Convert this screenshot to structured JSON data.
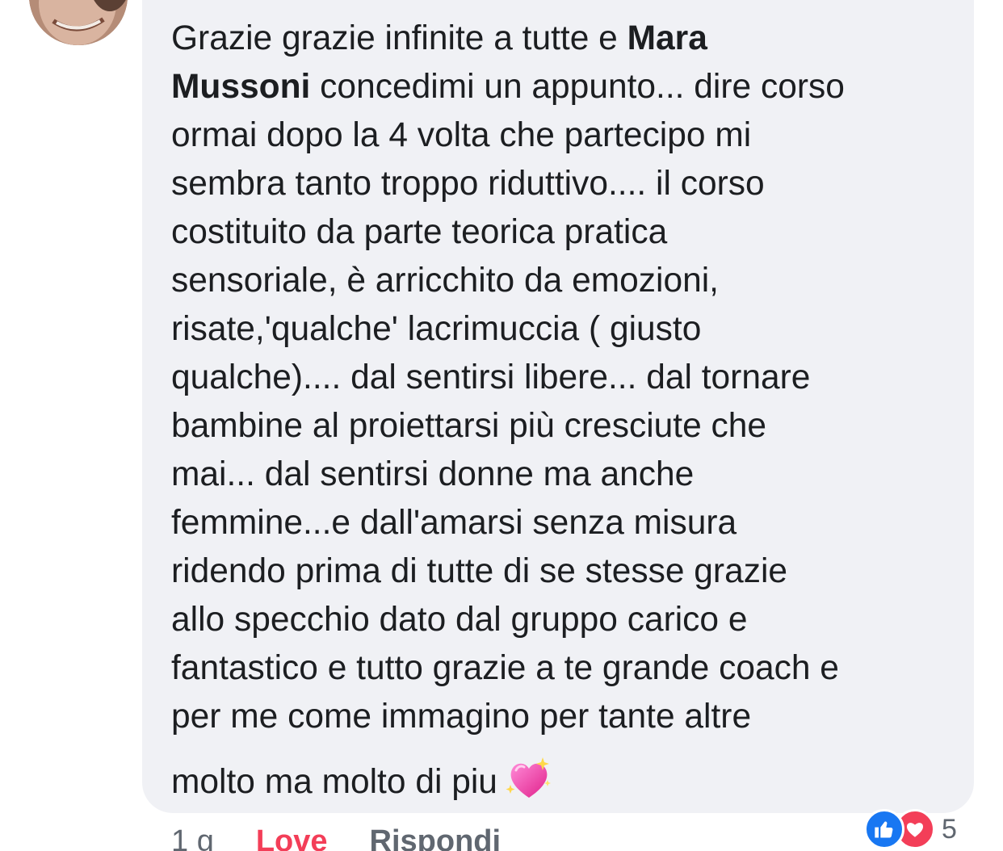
{
  "comment": {
    "author": "",
    "lines": [
      {
        "before": "Grazie grazie infinite a tutte e ",
        "mention": "Mara"
      },
      {
        "mention": "Mussoni",
        "after": " concedimi un appunto... dire corso"
      },
      "ormai dopo la 4 volta che partecipo mi",
      "sembra tanto troppo riduttivo.... il corso",
      "costituito da parte teorica pratica",
      "sensoriale, è arricchito da emozioni,",
      "risate,'qualche' lacrimuccia ( giusto",
      "qualche).... dal sentirsi libere... dal tornare",
      "bambine al proiettarsi più cresciute che",
      "mai... dal sentirsi donne ma anche",
      "femmine...e  dall'amarsi senza misura",
      "ridendo prima di tutte di se stesse grazie",
      "allo specchio dato dal gruppo carico e",
      "fantastico e tutto grazie a te grande coach e",
      "per me come immagino per tante altre",
      "molto ma molto di piu"
    ],
    "emoji": "sparkling-heart"
  },
  "reactions": {
    "icons": [
      "like-icon",
      "love-icon"
    ],
    "count": "5"
  },
  "actions": {
    "time": "1 g",
    "love": "Love",
    "reply": "Rispondi"
  },
  "colors": {
    "bubble": "#f0f1f5",
    "text": "#1c1e21",
    "love": "#f33e58",
    "like": "#1877f2",
    "secondary": "#606770"
  }
}
